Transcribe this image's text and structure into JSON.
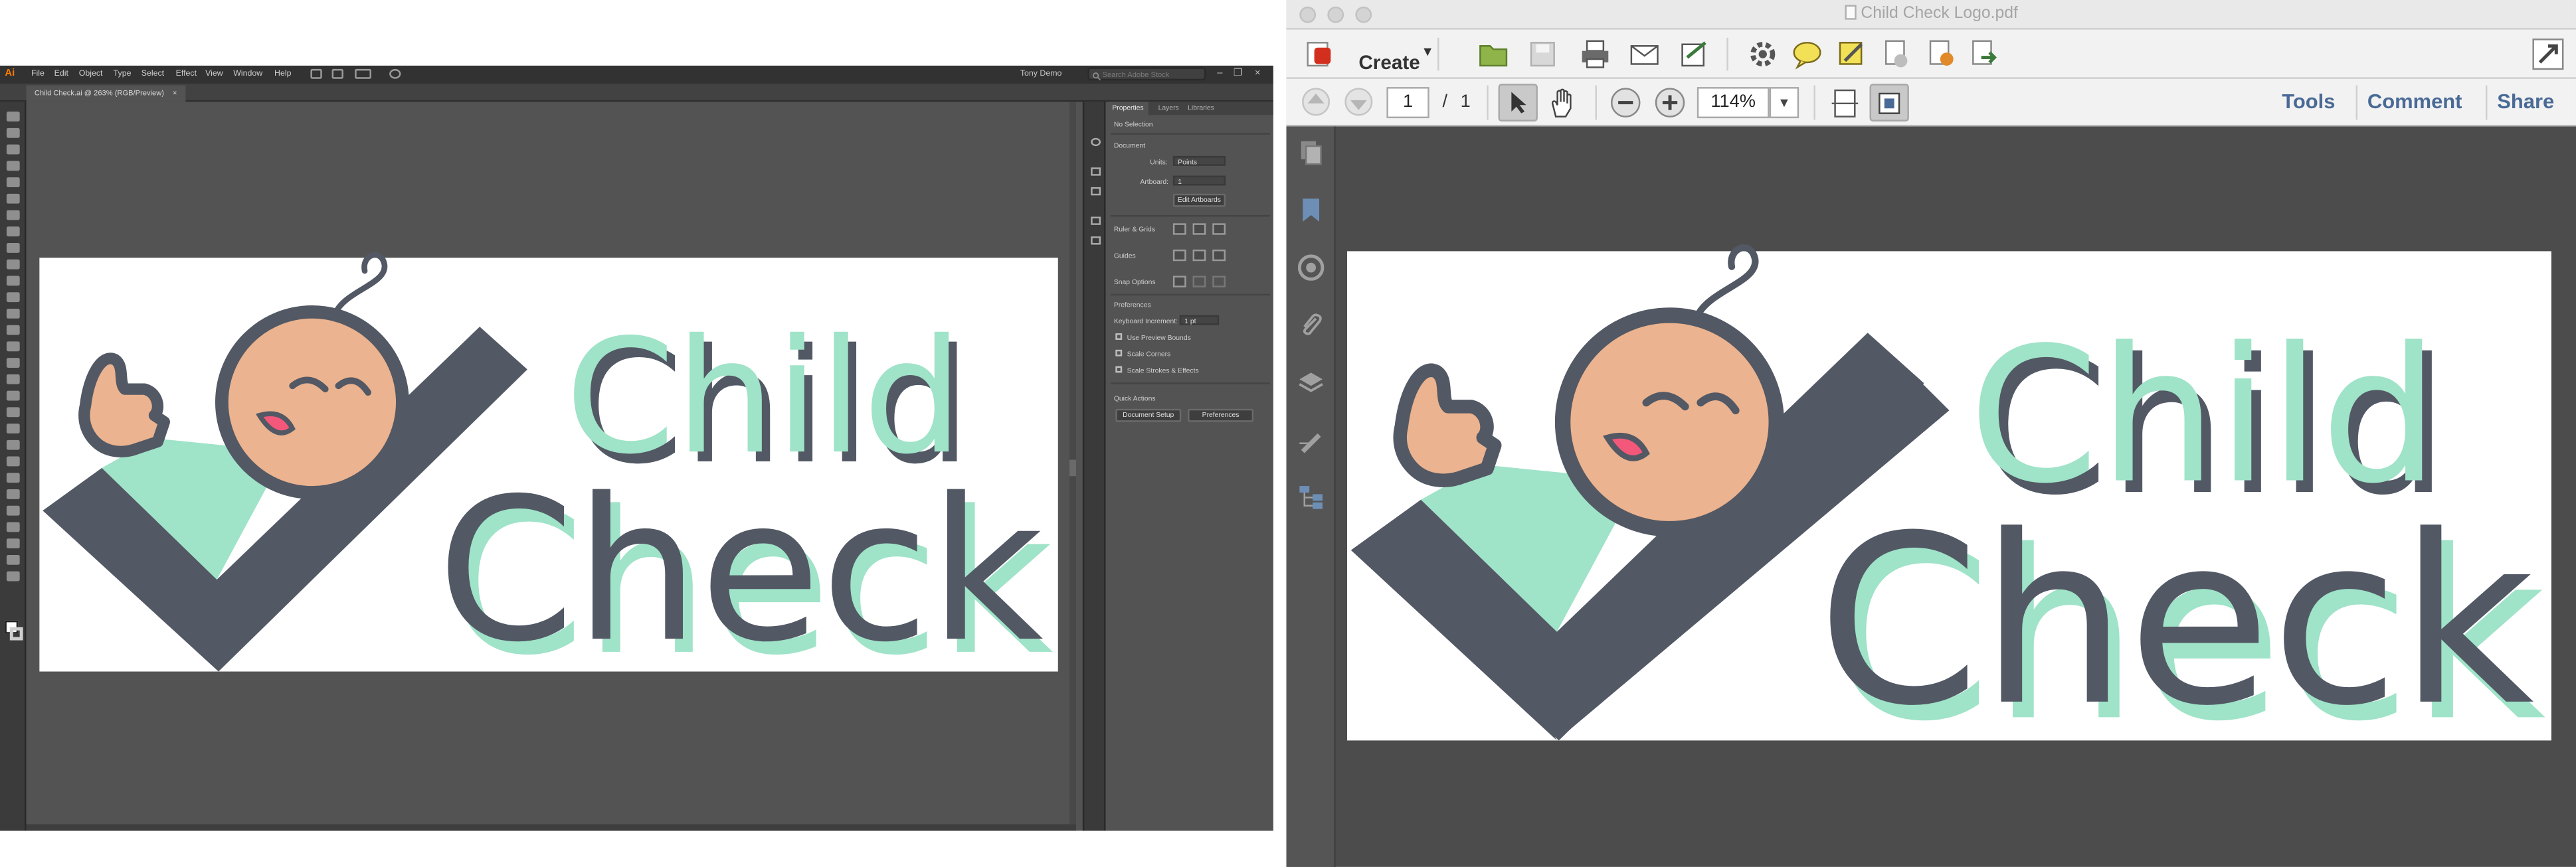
{
  "illustrator": {
    "app_logo": "Ai",
    "menu": [
      "File",
      "Edit",
      "Object",
      "Type",
      "Select",
      "Effect",
      "View",
      "Window",
      "Help"
    ],
    "user": "Tony Demo",
    "search_placeholder": "Search Adobe Stock",
    "doc_tab": "Child Check.ai @ 263% (RGB/Preview)",
    "doc_close": "×",
    "panel": {
      "tabs": [
        "Properties",
        "Layers",
        "Libraries"
      ],
      "no_selection": "No Selection",
      "document_heading": "Document",
      "units_label": "Units:",
      "units_value": "Points",
      "artboard_label": "Artboard:",
      "artboard_value": "1",
      "edit_artboards": "Edit Artboards",
      "ruler_grids": "Ruler & Grids",
      "guides": "Guides",
      "snap_options": "Snap Options",
      "preferences_heading": "Preferences",
      "keyboard_increment_label": "Keyboard Increment:",
      "keyboard_increment_value": "1 pt",
      "use_preview_bounds": "Use Preview Bounds",
      "scale_corners": "Scale Corners",
      "scale_strokes": "Scale Strokes & Effects",
      "quick_actions": "Quick Actions",
      "document_setup": "Document Setup",
      "preferences_button": "Preferences"
    }
  },
  "acrobat": {
    "window_title": "Child Check Logo.pdf",
    "create_label": "Create",
    "page_current": "1",
    "page_separator": "/",
    "page_total": "1",
    "zoom": "114%",
    "links": {
      "tools": "Tools",
      "comment": "Comment",
      "share": "Share"
    }
  },
  "logo": {
    "line1": "Child",
    "line2": "Check"
  },
  "colors": {
    "mint": "#9fe3c8",
    "slate": "#525864",
    "skin": "#ebb38f",
    "mouth": "#f3577a",
    "ai_bg": "#535353",
    "acrobat_link": "#4a6a96"
  }
}
